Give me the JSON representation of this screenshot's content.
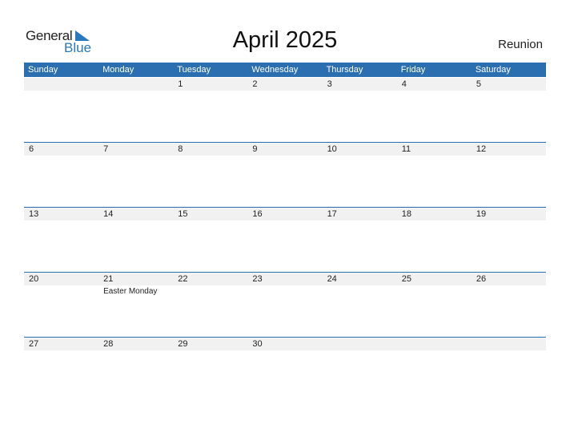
{
  "logo": {
    "line1": "General",
    "line2": "Blue"
  },
  "title": "April 2025",
  "region": "Reunion",
  "colors": {
    "accent": "#2c6fb0",
    "strip": "#f1f1f1"
  },
  "weekdays": [
    "Sunday",
    "Monday",
    "Tuesday",
    "Wednesday",
    "Thursday",
    "Friday",
    "Saturday"
  ],
  "weeks": [
    [
      {
        "d": ""
      },
      {
        "d": ""
      },
      {
        "d": "1"
      },
      {
        "d": "2"
      },
      {
        "d": "3"
      },
      {
        "d": "4"
      },
      {
        "d": "5"
      }
    ],
    [
      {
        "d": "6"
      },
      {
        "d": "7"
      },
      {
        "d": "8"
      },
      {
        "d": "9"
      },
      {
        "d": "10"
      },
      {
        "d": "11"
      },
      {
        "d": "12"
      }
    ],
    [
      {
        "d": "13"
      },
      {
        "d": "14"
      },
      {
        "d": "15"
      },
      {
        "d": "16"
      },
      {
        "d": "17"
      },
      {
        "d": "18"
      },
      {
        "d": "19"
      }
    ],
    [
      {
        "d": "20"
      },
      {
        "d": "21",
        "e": "Easter Monday"
      },
      {
        "d": "22"
      },
      {
        "d": "23"
      },
      {
        "d": "24"
      },
      {
        "d": "25"
      },
      {
        "d": "26"
      }
    ],
    [
      {
        "d": "27"
      },
      {
        "d": "28"
      },
      {
        "d": "29"
      },
      {
        "d": "30"
      },
      {
        "d": ""
      },
      {
        "d": ""
      },
      {
        "d": ""
      }
    ]
  ]
}
